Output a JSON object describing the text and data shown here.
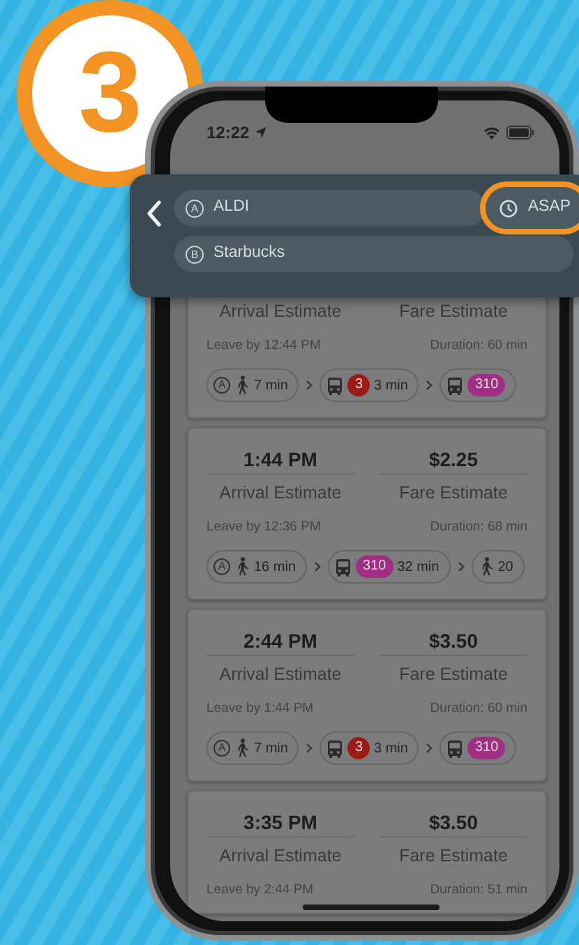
{
  "step": {
    "number": "3"
  },
  "status_bar": {
    "time": "12:22"
  },
  "search": {
    "origin": {
      "marker": "A",
      "name": "ALDI"
    },
    "destination": {
      "marker": "B",
      "name": "Starbucks"
    },
    "time_button": {
      "label": "ASAP",
      "highlighted": true
    }
  },
  "trips": [
    {
      "arrival_label": "Arrival Estimate",
      "fare_label": "Fare Estimate",
      "leave_by": "Leave by 12:44 PM",
      "duration": "Duration: 60 min",
      "legs": [
        {
          "kind": "walk",
          "marker": "A",
          "duration": "7 min"
        },
        {
          "kind": "bus",
          "route": "3",
          "color": "#9e1b13",
          "duration": "3 min"
        },
        {
          "kind": "bus",
          "route": "310",
          "color": "#a02e82"
        }
      ]
    },
    {
      "arrival_time": "1:44 PM",
      "fare": "$2.25",
      "arrival_label": "Arrival Estimate",
      "fare_label": "Fare Estimate",
      "leave_by": "Leave by 12:36 PM",
      "duration": "Duration: 68 min",
      "legs": [
        {
          "kind": "walk",
          "marker": "A",
          "duration": "16 min"
        },
        {
          "kind": "bus",
          "route": "310",
          "color": "#a02e82",
          "duration": "32 min"
        },
        {
          "kind": "walk",
          "duration": "20"
        }
      ]
    },
    {
      "arrival_time": "2:44 PM",
      "fare": "$3.50",
      "arrival_label": "Arrival Estimate",
      "fare_label": "Fare Estimate",
      "leave_by": "Leave by 1:44 PM",
      "duration": "Duration: 60 min",
      "legs": [
        {
          "kind": "walk",
          "marker": "A",
          "duration": "7 min"
        },
        {
          "kind": "bus",
          "route": "3",
          "color": "#9e1b13",
          "duration": "3 min"
        },
        {
          "kind": "bus",
          "route": "310",
          "color": "#a02e82"
        }
      ]
    },
    {
      "arrival_time": "3:35 PM",
      "fare": "$3.50",
      "arrival_label": "Arrival Estimate",
      "fare_label": "Fare Estimate",
      "leave_by": "Leave by 2:44 PM",
      "duration": "Duration: 51 min"
    }
  ]
}
